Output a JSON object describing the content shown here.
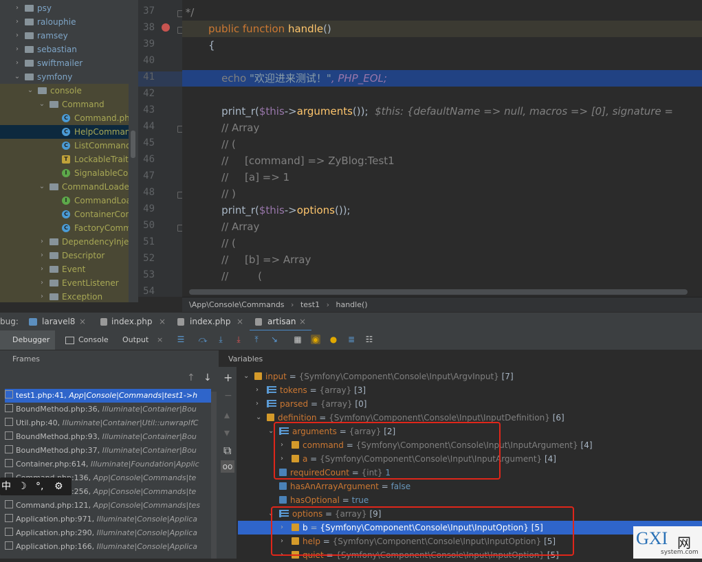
{
  "project_tree": {
    "items": [
      {
        "label": "psy",
        "color": "#7fa6c8",
        "type": "folder",
        "arrow": "›",
        "state": "normal"
      },
      {
        "label": "ralouphie",
        "color": "#7fa6c8",
        "type": "folder",
        "arrow": "›",
        "state": "normal"
      },
      {
        "label": "ramsey",
        "color": "#7fa6c8",
        "type": "folder",
        "arrow": "›",
        "state": "normal"
      },
      {
        "label": "sebastian",
        "color": "#7fa6c8",
        "type": "folder",
        "arrow": "›",
        "state": "normal"
      },
      {
        "label": "swiftmailer",
        "color": "#7fa6c8",
        "type": "folder",
        "arrow": "›",
        "state": "normal"
      },
      {
        "label": "symfony",
        "color": "#7fa6c8",
        "type": "folder",
        "arrow": "⌄",
        "state": "normal"
      },
      {
        "label": "console",
        "color": "#a8a855",
        "type": "folder",
        "arrow": "⌄",
        "state": "ylw"
      },
      {
        "label": "Command",
        "color": "#a8a855",
        "type": "folder",
        "arrow": "⌄",
        "state": "ylw"
      },
      {
        "label": "Command.php",
        "color": "#a8a855",
        "type": "class",
        "badge": "C",
        "state": "ylw"
      },
      {
        "label": "HelpCommand",
        "color": "#a8a855",
        "type": "class",
        "badge": "C",
        "state": "sel"
      },
      {
        "label": "ListCommand",
        "color": "#a8a855",
        "type": "class",
        "badge": "C",
        "state": "ylw"
      },
      {
        "label": "LockableTrait",
        "color": "#a8a855",
        "type": "trait",
        "badge": "T",
        "state": "ylw"
      },
      {
        "label": "SignalableCon",
        "color": "#a8a855",
        "type": "interface",
        "badge": "I",
        "state": "ylw"
      },
      {
        "label": "CommandLoader",
        "color": "#a8a855",
        "type": "folder",
        "arrow": "⌄",
        "state": "ylw"
      },
      {
        "label": "CommandLoa",
        "color": "#a8a855",
        "type": "interface",
        "badge": "I",
        "state": "ylw"
      },
      {
        "label": "ContainerCom",
        "color": "#a8a855",
        "type": "class",
        "badge": "C",
        "state": "ylw"
      },
      {
        "label": "FactoryComm",
        "color": "#a8a855",
        "type": "class",
        "badge": "C",
        "state": "ylw"
      },
      {
        "label": "DependencyInjec",
        "color": "#a8a855",
        "type": "folder",
        "arrow": "›",
        "state": "ylw"
      },
      {
        "label": "Descriptor",
        "color": "#a8a855",
        "type": "folder",
        "arrow": "›",
        "state": "ylw"
      },
      {
        "label": "Event",
        "color": "#a8a855",
        "type": "folder",
        "arrow": "›",
        "state": "ylw"
      },
      {
        "label": "EventListener",
        "color": "#a8a855",
        "type": "folder",
        "arrow": "›",
        "state": "ylw"
      },
      {
        "label": "Exception",
        "color": "#a8a855",
        "type": "folder",
        "arrow": "›",
        "state": "ylw"
      }
    ]
  },
  "editor": {
    "line_numbers": [
      "37",
      "38",
      "39",
      "40",
      "41",
      "42",
      "43",
      "44",
      "45",
      "46",
      "47",
      "48",
      "49",
      "50",
      "51",
      "52",
      "53",
      "54"
    ],
    "code": {
      "l37": " */",
      "l38_kw": "public function ",
      "l38_fn": "handle",
      "l38_rest": "()",
      "l39": "{",
      "l41_echo": "    echo ",
      "l41_str": "\"欢迎进来测试！\"",
      "l41_const": ", PHP_EOL;",
      "l43_a": "    print_r(",
      "l43_var": "$this",
      "l43_b": "->",
      "l43_fn": "arguments",
      "l43_c": "());",
      "l43_hint": "  $this: {defaultName => null, macros => [0], signature = ",
      "l44": "    // Array",
      "l45": "    // (",
      "l46": "    //     [command] => ZyBlog:Test1",
      "l47": "    //     [a] => 1",
      "l48": "    // )",
      "l49_a": "    print_r(",
      "l49_var": "$this",
      "l49_b": "->",
      "l49_fn": "options",
      "l49_c": "());",
      "l50": "    // Array",
      "l51": "    // (",
      "l52": "    //     [b] => Array",
      "l53": "    //         ("
    }
  },
  "breadcrumb": {
    "path": "\\App\\Console\\Commands",
    "sep1": "›",
    "cls": "test1",
    "sep2": "›",
    "method": "handle()"
  },
  "debug_tabs": {
    "prefix": "bug:",
    "tabs": [
      {
        "label": "laravel8"
      },
      {
        "label": "index.php"
      },
      {
        "label": "index.php"
      },
      {
        "label": "artisan"
      }
    ]
  },
  "debug_toolbar": {
    "debugger": "Debugger",
    "console": "Console",
    "output": "Output"
  },
  "frames": {
    "header": "Frames",
    "items": [
      {
        "file": "test1.php:41,",
        "ns": "App|Console|Commands|test1->h"
      },
      {
        "file": "BoundMethod.php:36,",
        "ns": "Illuminate|Container|Bou"
      },
      {
        "file": "Util.php:40,",
        "ns": "Illuminate|Container|Util::unwrapIfC"
      },
      {
        "file": "BoundMethod.php:93,",
        "ns": "Illuminate|Container|Bou"
      },
      {
        "file": "BoundMethod.php:37,",
        "ns": "Illuminate|Container|Bou"
      },
      {
        "file": "Container.php:614,",
        "ns": "Illuminate|Foundation|Applic"
      },
      {
        "file": "Command.php:136,",
        "ns": "App|Console|Commands|te"
      },
      {
        "file": "Command.php:256,",
        "ns": "App|Console|Commands|te"
      },
      {
        "file": "Command.php:121,",
        "ns": "App|Console|Commands|tes"
      },
      {
        "file": "Application.php:971,",
        "ns": "Illuminate|Console|Applica"
      },
      {
        "file": "Application.php:290,",
        "ns": "Illuminate|Console|Applica"
      },
      {
        "file": "Application.php:166,",
        "ns": "Illuminate|Console|Applica"
      }
    ],
    "mini_toolbar": [
      "中",
      "☽",
      "°,",
      "⚙"
    ]
  },
  "variables": {
    "header": "Variables",
    "rows": [
      {
        "name": "input",
        "type": "{Symfony\\Component\\Console\\Input\\ArgvInput}",
        "count": "[7]",
        "arrow": "⌄",
        "indent": 0,
        "icon": "obj"
      },
      {
        "name": "tokens",
        "type": "{array}",
        "count": "[3]",
        "arrow": "›",
        "indent": 1,
        "icon": "arr"
      },
      {
        "name": "parsed",
        "type": "{array}",
        "count": "[0]",
        "arrow": "›",
        "indent": 1,
        "icon": "arr"
      },
      {
        "name": "definition",
        "type": "{Symfony\\Component\\Console\\Input\\InputDefinition}",
        "count": "[6]",
        "arrow": "⌄",
        "indent": 1,
        "icon": "obj"
      },
      {
        "name": "arguments",
        "type": "{array}",
        "count": "[2]",
        "arrow": "⌄",
        "indent": 2,
        "icon": "arr"
      },
      {
        "name": "command",
        "type": "{Symfony\\Component\\Console\\Input\\InputArgument}",
        "count": "[4]",
        "arrow": "›",
        "indent": 3,
        "icon": "obj"
      },
      {
        "name": "a",
        "type": "{Symfony\\Component\\Console\\Input\\InputArgument}",
        "count": "[4]",
        "arrow": "›",
        "indent": 3,
        "icon": "obj"
      },
      {
        "name": "requiredCount",
        "type": "{int}",
        "count": "1",
        "arrow": "",
        "indent": 2,
        "icon": "prim"
      },
      {
        "name": "hasAnArrayArgument",
        "type": "",
        "count": "false",
        "arrow": "",
        "indent": 2,
        "icon": "prim"
      },
      {
        "name": "hasOptional",
        "type": "",
        "count": "true",
        "arrow": "",
        "indent": 2,
        "icon": "prim"
      },
      {
        "name": "options",
        "type": "{array}",
        "count": "[9]",
        "arrow": "⌄",
        "indent": 2,
        "icon": "arr"
      },
      {
        "name": "b",
        "type": "{Symfony\\Component\\Console\\Input\\InputOption}",
        "count": "[5]",
        "arrow": "›",
        "indent": 3,
        "icon": "obj",
        "selected": true
      },
      {
        "name": "help",
        "type": "{Symfony\\Component\\Console\\Input\\InputOption}",
        "count": "[5]",
        "arrow": "›",
        "indent": 3,
        "icon": "obj"
      },
      {
        "name": "quiet",
        "type": "{Symfony\\Component\\Console\\Input\\InputOption}",
        "count": "[5]",
        "arrow": "›",
        "indent": 3,
        "icon": "obj"
      }
    ]
  },
  "watermark": {
    "logo": "GXI",
    "suffix": "网",
    "sub": "system.com"
  },
  "colors": {
    "accent": "#2f65ca",
    "highlight_line": "#214283",
    "red_box": "#e0261a",
    "selected_tree": "#0d293e"
  }
}
